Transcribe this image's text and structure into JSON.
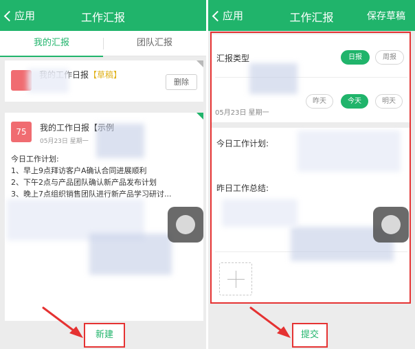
{
  "left_screen": {
    "header": {
      "back_label": "应用",
      "title": "工作汇报"
    },
    "tabs": [
      {
        "label": "我的汇报",
        "active": true
      },
      {
        "label": "团队汇报",
        "active": false
      }
    ],
    "draft_card": {
      "title": "我的工作日报",
      "tag": "【草稿】",
      "delete_label": "删除"
    },
    "report_card": {
      "avatar_text": "75",
      "title": "我的工作日报【示例",
      "date": "05月23日 星期一",
      "plan_heading": "今日工作计划:",
      "plan_items": [
        "1、早上9点拜访客户A确认合同进展顺利",
        "2、下午2点与产品团队确认新产品发布计划",
        "3、晚上7点组织销售团队进行新产品学习研讨..."
      ]
    },
    "bottom_button": "新建"
  },
  "right_screen": {
    "header": {
      "back_label": "应用",
      "title": "工作汇报",
      "action": "保存草稿"
    },
    "report_type": {
      "label": "汇报类型",
      "options": [
        {
          "label": "日报",
          "selected": true
        },
        {
          "label": "周报",
          "selected": false
        }
      ]
    },
    "date_row": {
      "date": "05月23日 星期一",
      "options": [
        {
          "label": "昨天",
          "selected": false
        },
        {
          "label": "今天",
          "selected": true
        },
        {
          "label": "明天",
          "selected": false
        }
      ]
    },
    "fields": {
      "today_plan": "今日工作计划:",
      "yesterday_summary": "昨日工作总结:"
    },
    "bottom_button": "提交"
  },
  "colors": {
    "accent_green": "#20b46b",
    "annotation_red": "#e53232",
    "avatar_red": "#f06c71",
    "draft_tag_yellow": "#e0b21b"
  }
}
